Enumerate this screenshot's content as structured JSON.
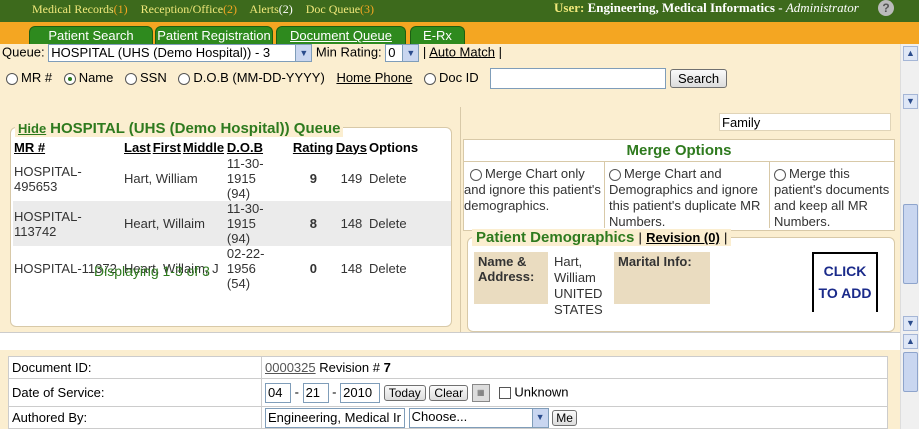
{
  "topbar": {
    "links": [
      {
        "label": "Medical Records",
        "count": "(1)"
      },
      {
        "label": "Reception/Office",
        "count": "(2)"
      },
      {
        "label": "Alerts",
        "count": "(2)"
      },
      {
        "label": "Doc Queue",
        "count": "(3)"
      }
    ],
    "user_label": "User:",
    "user_name": "Engineering, Medical Informatics -",
    "user_role": "Administrator",
    "help_icon": "?"
  },
  "tabs": [
    {
      "label": "Patient Search"
    },
    {
      "label": "Patient Registration"
    },
    {
      "label": "Document Queue"
    },
    {
      "label": "E-Rx"
    }
  ],
  "queue_bar": {
    "queue_label": "Queue:",
    "queue_value": "HOSPITAL (UHS (Demo Hospital)) - 3",
    "min_rating_label": "Min Rating:",
    "min_rating_value": "0",
    "auto_match": "Auto Match",
    "sep": "|"
  },
  "search": {
    "options": [
      "MR #",
      "Name",
      "SSN",
      "D.O.B (MM-DD-YYYY)",
      "Home Phone",
      "Doc ID"
    ],
    "selected": "Name",
    "value": "",
    "button": "Search"
  },
  "queue": {
    "hide": "Hide",
    "title": "HOSPITAL (UHS (Demo Hospital)) Queue",
    "columns": [
      "MR #",
      "Last",
      "First",
      "Middle",
      "D.O.B",
      "Rating",
      "Days",
      "Options"
    ],
    "rows": [
      {
        "mr": "HOSPITAL-495653",
        "name": "Hart, William",
        "dob": "11-30-1915",
        "age": "(94)",
        "rating": "9",
        "days": "149",
        "option": "Delete"
      },
      {
        "mr": "HOSPITAL-113742",
        "name": "Heart, Willaim",
        "dob": "11-30-1915",
        "age": "(94)",
        "rating": "8",
        "days": "148",
        "option": "Delete"
      },
      {
        "mr": "HOSPITAL-11372",
        "name": "Heart, Willaim, J",
        "dob": "02-22-1956",
        "age": "(54)",
        "rating": "0",
        "days": "148",
        "option": "Delete"
      }
    ],
    "displaying": "Displaying 1-3 of 3"
  },
  "right": {
    "family_label": "Family",
    "merge_title": "Merge Options",
    "merge_options": [
      "Merge Chart only and ignore this patient's demographics.",
      "Merge Chart and Demographics and ignore this patient's duplicate MR Numbers.",
      "Merge this patient's documents and keep all MR Numbers."
    ],
    "demo_title": "Patient Demographics",
    "revision": "Revision (0)",
    "bar": "|",
    "name_label": "Name & Address:",
    "name_value": "Hart, William UNITED STATES",
    "marital_label": "Marital Info:",
    "marital_value": "",
    "click_to_add": "CLICK TO ADD"
  },
  "doc": {
    "doc_id_label": "Document ID:",
    "doc_id": "0000325",
    "revision_label": "Revision #",
    "revision": "7",
    "dos_label": "Date of Service:",
    "dos_month": "04",
    "dos_day": "21",
    "dos_year": "2010",
    "today": "Today",
    "clear": "Clear",
    "unknown": "Unknown",
    "authored_label": "Authored By:",
    "authored_value": "Engineering, Medical Ir",
    "choose": "Choose...",
    "me": "Me"
  },
  "colors": {
    "topbar": "#3d6a1c",
    "tabbar": "#f4a622",
    "tab": "#2e8a1e",
    "panel_bg": "#fbeed0",
    "title_green": "#2e7a1e"
  }
}
